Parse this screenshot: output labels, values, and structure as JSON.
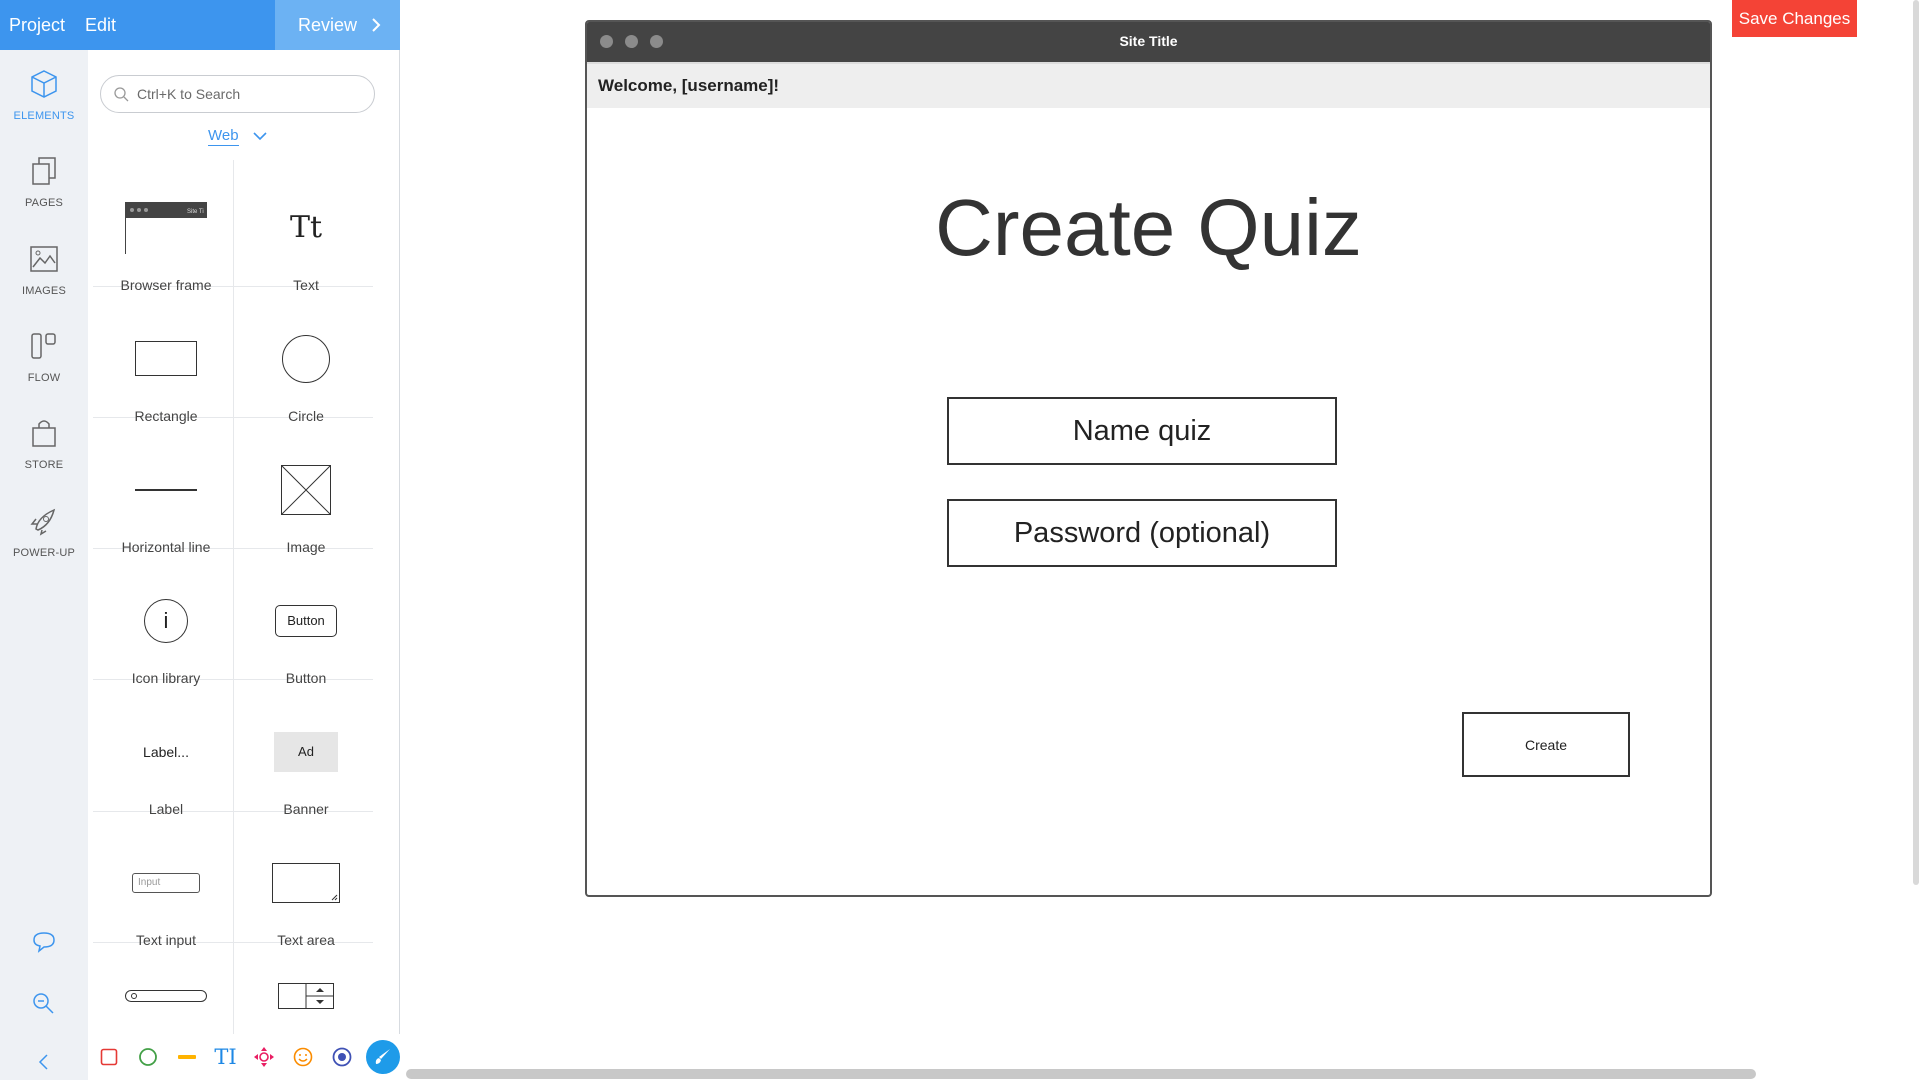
{
  "topbar": {
    "project": "Project",
    "edit": "Edit",
    "review": "Review"
  },
  "rail": {
    "items": [
      {
        "label": "ELEMENTS",
        "icon": "cube-icon"
      },
      {
        "label": "PAGES",
        "icon": "pages-icon"
      },
      {
        "label": "IMAGES",
        "icon": "image-icon"
      },
      {
        "label": "FLOW",
        "icon": "flow-icon"
      },
      {
        "label": "STORE",
        "icon": "bag-icon"
      },
      {
        "label": "POWER-UP",
        "icon": "rocket-icon"
      }
    ],
    "bottom": [
      "comment-icon",
      "zoom-icon",
      "collapse-icon"
    ]
  },
  "panel": {
    "search_placeholder": "Ctrl+K to Search",
    "category": "Web",
    "elements": [
      "Browser frame",
      "Text",
      "Rectangle",
      "Circle",
      "Horizontal line",
      "Image",
      "Icon library",
      "Button",
      "Label",
      "Banner",
      "Text input",
      "Text area"
    ],
    "previews": {
      "text_glyph": "Tt",
      "frame_title": "Site Ti",
      "icon_glyph": "i",
      "button_text": "Button",
      "label_text": "Label...",
      "banner_text": "Ad",
      "input_text": "Input"
    },
    "bottom_tools": [
      "rectangle-tool-icon",
      "circle-tool-icon",
      "line-tool-icon",
      "text-tool-icon",
      "move-tool-icon",
      "emoji-tool-icon",
      "target-tool-icon",
      "brush-tool-icon"
    ],
    "text_tool_glyph": "TI"
  },
  "canvas": {
    "save_label": "Save Changes",
    "frame": {
      "site_title": "Site Title",
      "welcome": "Welcome, [username]!",
      "heading": "Create Quiz",
      "name_field": "Name quiz",
      "password_field": "Password (optional)",
      "create_button": "Create"
    }
  },
  "colors": {
    "accent": "#3d95ee",
    "accent_light": "#6cb2f3",
    "save": "#f44336",
    "titlebar": "#444444"
  }
}
